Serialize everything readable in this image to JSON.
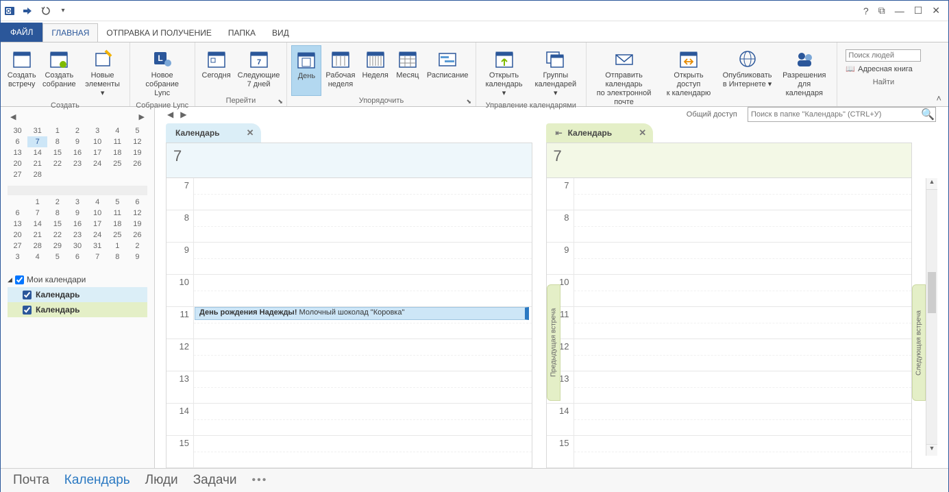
{
  "tabs": {
    "file": "ФАЙЛ",
    "home": "ГЛАВНАЯ",
    "sendrecv": "ОТПРАВКА И ПОЛУЧЕНИЕ",
    "folder": "ПАПКА",
    "view": "ВИД"
  },
  "ribbon": {
    "groups": {
      "create": {
        "label": "Создать",
        "new_appt": "Создать\nвстречу",
        "new_meeting": "Создать\nсобрание",
        "new_items": "Новые\nэлементы ▾"
      },
      "lync": {
        "label": "Собрание Lync",
        "btn": "Новое\nсобрание Lync"
      },
      "goto": {
        "label": "Перейти",
        "today": "Сегодня",
        "next7": "Следующие\n7 дней"
      },
      "arrange": {
        "label": "Упорядочить",
        "day": "День",
        "workweek": "Рабочая\nнеделя",
        "week": "Неделя",
        "month": "Месяц",
        "schedule": "Расписание"
      },
      "manage": {
        "label": "Управление календарями",
        "open": "Открыть\nкалендарь ▾",
        "groups": "Группы\nкалендарей ▾"
      },
      "share": {
        "label": "Общий доступ",
        "email": "Отправить календарь\nпо электронной почте",
        "sharecal": "Открыть доступ\nк календарю",
        "publish": "Опубликовать\nв Интернете ▾",
        "perms": "Разрешения\nдля календаря"
      },
      "find": {
        "label": "Найти",
        "placeholder": "Поиск людей",
        "addressbook": "Адресная книга"
      }
    }
  },
  "mini_cal_1": [
    [
      "30",
      "31",
      "1",
      "2",
      "3",
      "4",
      "5"
    ],
    [
      "6",
      "7",
      "8",
      "9",
      "10",
      "11",
      "12"
    ],
    [
      "13",
      "14",
      "15",
      "16",
      "17",
      "18",
      "19"
    ],
    [
      "20",
      "21",
      "22",
      "23",
      "24",
      "25",
      "26"
    ],
    [
      "27",
      "28",
      "",
      "",
      "",
      "",
      ""
    ]
  ],
  "mini_cal_2_hdr": [
    "",
    "1",
    "2",
    "3",
    "4",
    "5",
    "6"
  ],
  "mini_cal_2": [
    [
      "6",
      "7",
      "8",
      "9",
      "10",
      "11",
      "12"
    ],
    [
      "13",
      "14",
      "15",
      "16",
      "17",
      "18",
      "19"
    ],
    [
      "20",
      "21",
      "22",
      "23",
      "24",
      "25",
      "26"
    ],
    [
      "27",
      "28",
      "29",
      "30",
      "31",
      "1",
      "2"
    ],
    [
      "3",
      "4",
      "5",
      "6",
      "7",
      "8",
      "9"
    ]
  ],
  "mini_today": "7",
  "cal_list": {
    "header": "Мои календари",
    "item1": "Календарь",
    "item2": "Календарь"
  },
  "search_placeholder": "Поиск в папке \"Календарь\" (CTRL+У)",
  "view_tabs": {
    "left": "Календарь",
    "right": "Календарь"
  },
  "day_number": "7",
  "hours": [
    "7",
    "8",
    "9",
    "10",
    "11",
    "12",
    "13",
    "14",
    "15"
  ],
  "appointment": {
    "bold": "День рождения Надежды!",
    "rest": " Молочный шоколад \"Коровка\""
  },
  "side_handles": {
    "prev": "Предыдущая встреча",
    "next": "Следующая встреча"
  },
  "bottom": {
    "mail": "Почта",
    "calendar": "Календарь",
    "people": "Люди",
    "tasks": "Задачи"
  }
}
